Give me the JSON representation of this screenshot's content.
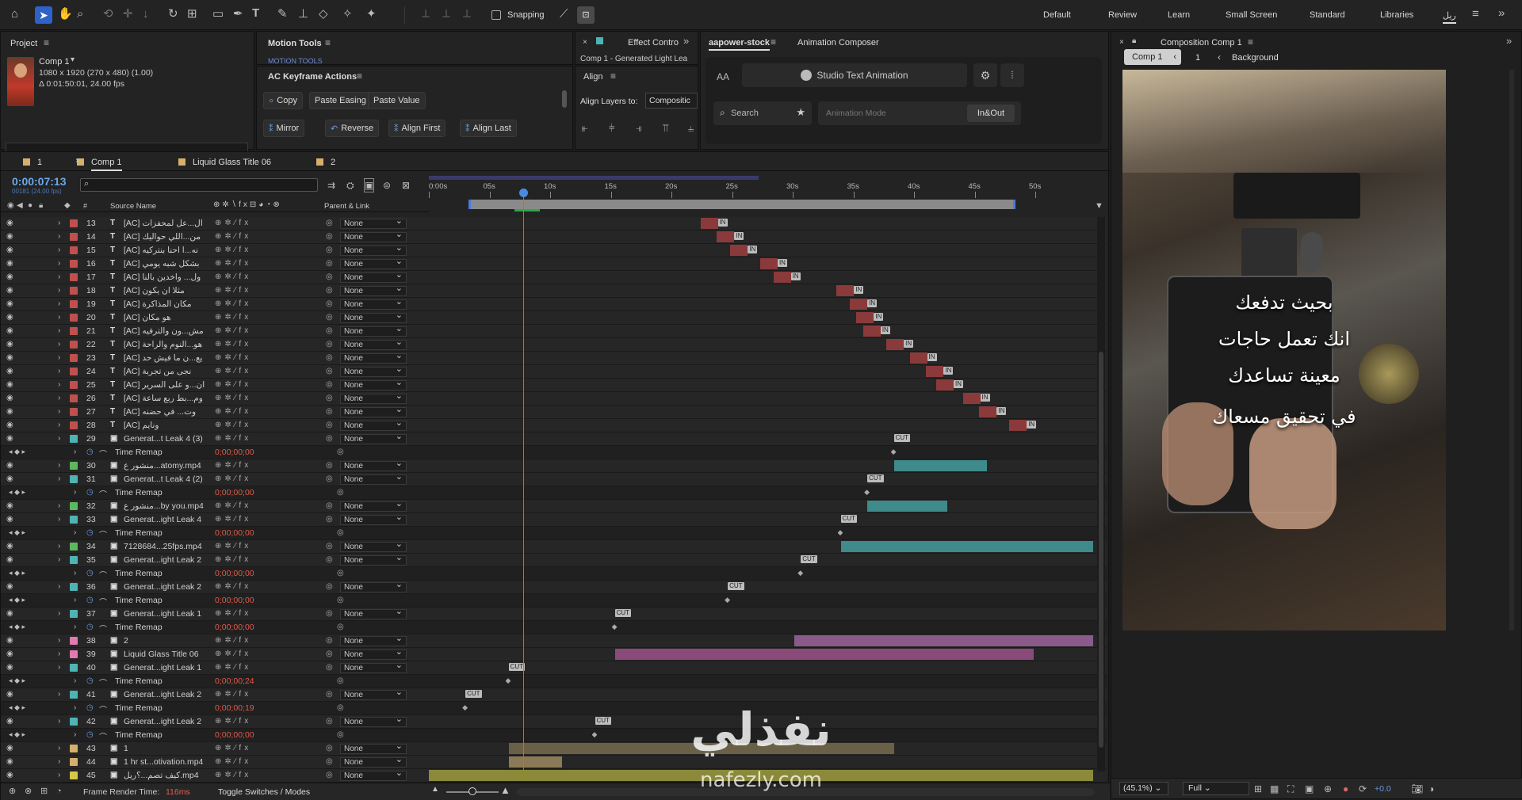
{
  "toolbar": {
    "snapping": "Snapping",
    "workspaces": [
      "Default",
      "Review",
      "Learn",
      "Small Screen",
      "Standard",
      "Libraries",
      "ريل"
    ]
  },
  "project": {
    "title": "Project",
    "comp_name": "Comp 1",
    "meta1": "1080 x 1920  (270 x 480) (1.00)",
    "meta2": "Δ 0:01:50:01, 24.00 fps"
  },
  "motion_tools": {
    "title": "Motion Tools",
    "sub": "MOTION TOOLS"
  },
  "ac": {
    "title": "AC Keyframe Actions",
    "copy": "Copy",
    "paste_easing": "Paste Easing",
    "paste_value": "Paste Value",
    "mirror": "Mirror",
    "reverse": "Reverse",
    "align_first": "Align First",
    "align_last": "Align Last"
  },
  "effect": {
    "tab": "Effect Contro",
    "sub": "Comp 1 - Generated Light Lea"
  },
  "align": {
    "title": "Align",
    "layers_to": "Align Layers to:",
    "target": "Compositic"
  },
  "aapower": {
    "tab": "aapower-stock",
    "tab2": "Animation Composer",
    "studio": "Studio Text Animation",
    "search": "Search",
    "mode": "Animation Mode",
    "inout": "In&Out",
    "aa": "AA"
  },
  "comp_panel": {
    "title": "Composition Comp 1",
    "chip": "Comp 1",
    "num": "1",
    "bg": "Background",
    "zoom": "(45.1%)",
    "quality": "Full",
    "exposure": "+0.0"
  },
  "preview_text": [
    "بحيث تدفعك",
    "انك تعمل حاجات",
    "معينة تساعدك",
    "في تحقيق مسعاك"
  ],
  "watermark": {
    "ar": "نفذلي",
    "url": "nafezly.com"
  },
  "timeline": {
    "tabs": [
      "1",
      "Comp 1",
      "Liquid Glass Title 06",
      "2"
    ],
    "timecode": "0:00:07:13",
    "fps": "00181 (24.00 fps)",
    "col_source": "Source Name",
    "col_parent": "Parent & Link",
    "ruler": [
      "0:00s",
      "05s",
      "10s",
      "15s",
      "20s",
      "25s",
      "30s",
      "35s",
      "40s",
      "45s",
      "50s"
    ],
    "footer_render": "Frame Render Time:",
    "footer_ms": "116ms",
    "footer_toggle": "Toggle Switches / Modes",
    "rows": [
      {
        "n": "13",
        "name": "[AC] ال...عل لمحفزات",
        "color": "#c0504d",
        "kind": "T",
        "parent": "None",
        "mark": "IN",
        "mx": 0.435
      },
      {
        "n": "14",
        "name": "[AC] من...اللي حواليك",
        "color": "#c0504d",
        "kind": "T",
        "parent": "None",
        "mark": "IN",
        "mx": 0.46
      },
      {
        "n": "15",
        "name": "[AC] نه...ا احنا بنتركيه",
        "color": "#c0504d",
        "kind": "T",
        "parent": "None",
        "mark": "IN",
        "mx": 0.48
      },
      {
        "n": "16",
        "name": "[AC] بشكل شبه يومي",
        "color": "#c0504d",
        "kind": "T",
        "parent": "None",
        "mark": "IN",
        "mx": 0.525
      },
      {
        "n": "17",
        "name": "[AC] ول... واخدين بالنا",
        "color": "#c0504d",
        "kind": "T",
        "parent": "None",
        "mark": "IN",
        "mx": 0.545
      },
      {
        "n": "18",
        "name": "[AC] مثلا ان يكون",
        "color": "#c0504d",
        "kind": "T",
        "parent": "None",
        "mark": "IN",
        "mx": 0.64
      },
      {
        "n": "19",
        "name": "[AC] مكان المذاكرة",
        "color": "#c0504d",
        "kind": "T",
        "parent": "None",
        "mark": "IN",
        "mx": 0.66
      },
      {
        "n": "20",
        "name": "[AC] هو مكان",
        "color": "#c0504d",
        "kind": "T",
        "parent": "None",
        "mark": "IN",
        "mx": 0.67
      },
      {
        "n": "21",
        "name": "[AC] مش...ون والترفيه",
        "color": "#c0504d",
        "kind": "T",
        "parent": "None",
        "mark": "IN",
        "mx": 0.68
      },
      {
        "n": "22",
        "name": "[AC] هو...النوم والراحة",
        "color": "#c0504d",
        "kind": "T",
        "parent": "None",
        "mark": "IN",
        "mx": 0.715
      },
      {
        "n": "23",
        "name": "[AC] يع...ن ما فيش حد",
        "color": "#c0504d",
        "kind": "T",
        "parent": "None",
        "mark": "IN",
        "mx": 0.75
      },
      {
        "n": "24",
        "name": "[AC] نجى من تجربة",
        "color": "#c0504d",
        "kind": "T",
        "parent": "None",
        "mark": "IN",
        "mx": 0.775
      },
      {
        "n": "25",
        "name": "[AC] ان...و على السرير",
        "color": "#c0504d",
        "kind": "T",
        "parent": "None",
        "mark": "IN",
        "mx": 0.79
      },
      {
        "n": "26",
        "name": "[AC] وم...بط ربع ساعة",
        "color": "#c0504d",
        "kind": "T",
        "parent": "None",
        "mark": "IN",
        "mx": 0.83
      },
      {
        "n": "27",
        "name": "[AC] وت... في حضنه",
        "color": "#c0504d",
        "kind": "T",
        "parent": "None",
        "mark": "IN",
        "mx": 0.855
      },
      {
        "n": "28",
        "name": "[AC] ونايم",
        "color": "#c0504d",
        "kind": "T",
        "parent": "None",
        "mark": "IN",
        "mx": 0.9
      },
      {
        "n": "29",
        "name": "Generat...t Leak 4 (3)",
        "color": "#4fb3b3",
        "kind": "C",
        "parent": "None",
        "mark": "CUT",
        "mx": 0.7
      },
      {
        "n": "",
        "name": "Time Remap",
        "sub": true,
        "val": "0;00;00;00"
      },
      {
        "n": "30",
        "name": "منشور ع...atomy.mp4",
        "color": "#5cb85c",
        "kind": "V",
        "parent": "None",
        "bar": [
          0.7,
          0.84,
          "#3f8a8a"
        ]
      },
      {
        "n": "31",
        "name": "Generat...t Leak 4 (2)",
        "color": "#4fb3b3",
        "kind": "C",
        "parent": "None",
        "mark": "CUT",
        "mx": 0.66
      },
      {
        "n": "",
        "name": "Time Remap",
        "sub": true,
        "val": "0;00;00;00"
      },
      {
        "n": "32",
        "name": "منشور ع...by you.mp4",
        "color": "#5cb85c",
        "kind": "V",
        "parent": "None",
        "bar": [
          0.66,
          0.78,
          "#3f8a8a"
        ]
      },
      {
        "n": "33",
        "name": "Generat...ight Leak 4",
        "color": "#4fb3b3",
        "kind": "C",
        "parent": "None",
        "mark": "CUT",
        "mx": 0.62
      },
      {
        "n": "",
        "name": "Time Remap",
        "sub": true,
        "val": "0;00;00;00"
      },
      {
        "n": "34",
        "name": "7128684...25fps.mp4",
        "color": "#5cb85c",
        "kind": "V",
        "parent": "None",
        "bar": [
          0.62,
          1.0,
          "#3f8a8a"
        ]
      },
      {
        "n": "35",
        "name": "Generat...ight Leak 2",
        "color": "#4fb3b3",
        "kind": "C",
        "parent": "None",
        "mark": "CUT",
        "mx": 0.56
      },
      {
        "n": "",
        "name": "Time Remap",
        "sub": true,
        "val": "0;00;00;00"
      },
      {
        "n": "36",
        "name": "Generat...ight Leak 2",
        "color": "#4fb3b3",
        "kind": "C",
        "parent": "None",
        "mark": "CUT",
        "mx": 0.45
      },
      {
        "n": "",
        "name": "Time Remap",
        "sub": true,
        "val": "0;00;00;00"
      },
      {
        "n": "37",
        "name": "Generat...ight Leak 1",
        "color": "#4fb3b3",
        "kind": "C",
        "parent": "None",
        "mark": "CUT",
        "mx": 0.28
      },
      {
        "n": "",
        "name": "Time Remap",
        "sub": true,
        "val": "0;00;00;00"
      },
      {
        "n": "38",
        "name": "2",
        "color": "#e07ab0",
        "kind": "C",
        "parent": "None",
        "bar": [
          0.55,
          1.0,
          "#8a5a8a"
        ]
      },
      {
        "n": "39",
        "name": "Liquid Glass Title 06",
        "color": "#e07ab0",
        "kind": "C",
        "parent": "None",
        "bar": [
          0.28,
          0.91,
          "#8a4a7a"
        ]
      },
      {
        "n": "40",
        "name": "Generat...ight Leak 1",
        "color": "#4fb3b3",
        "kind": "C",
        "parent": "None",
        "mark": "CUT",
        "mx": 0.12
      },
      {
        "n": "",
        "name": "Time Remap",
        "sub": true,
        "val": "0;00;00;24"
      },
      {
        "n": "41",
        "name": "Generat...ight Leak 2",
        "color": "#4fb3b3",
        "kind": "C",
        "parent": "None",
        "mark": "CUT",
        "mx": 0.055
      },
      {
        "n": "",
        "name": "Time Remap",
        "sub": true,
        "val": "0;00;00;19"
      },
      {
        "n": "42",
        "name": "Generat...ight Leak 2",
        "color": "#4fb3b3",
        "kind": "C",
        "parent": "None",
        "mark": "CUT",
        "mx": 0.25
      },
      {
        "n": "",
        "name": "Time Remap",
        "sub": true,
        "val": "0;00;00;00"
      },
      {
        "n": "43",
        "name": "1",
        "color": "#d4b06a",
        "kind": "C",
        "parent": "None",
        "bar": [
          0.12,
          0.7,
          "#6a6048"
        ]
      },
      {
        "n": "44",
        "name": "1 hr st...otivation.mp4",
        "color": "#d4b06a",
        "kind": "V",
        "parent": "None",
        "bar": [
          0.12,
          0.2,
          "#8a7a58"
        ]
      },
      {
        "n": "45",
        "name": "كيف تصم...؟ريل.mp4",
        "color": "#d4c84a",
        "kind": "V",
        "parent": "None",
        "bar": [
          0.0,
          1.0,
          "#8a8a3a"
        ]
      }
    ]
  }
}
